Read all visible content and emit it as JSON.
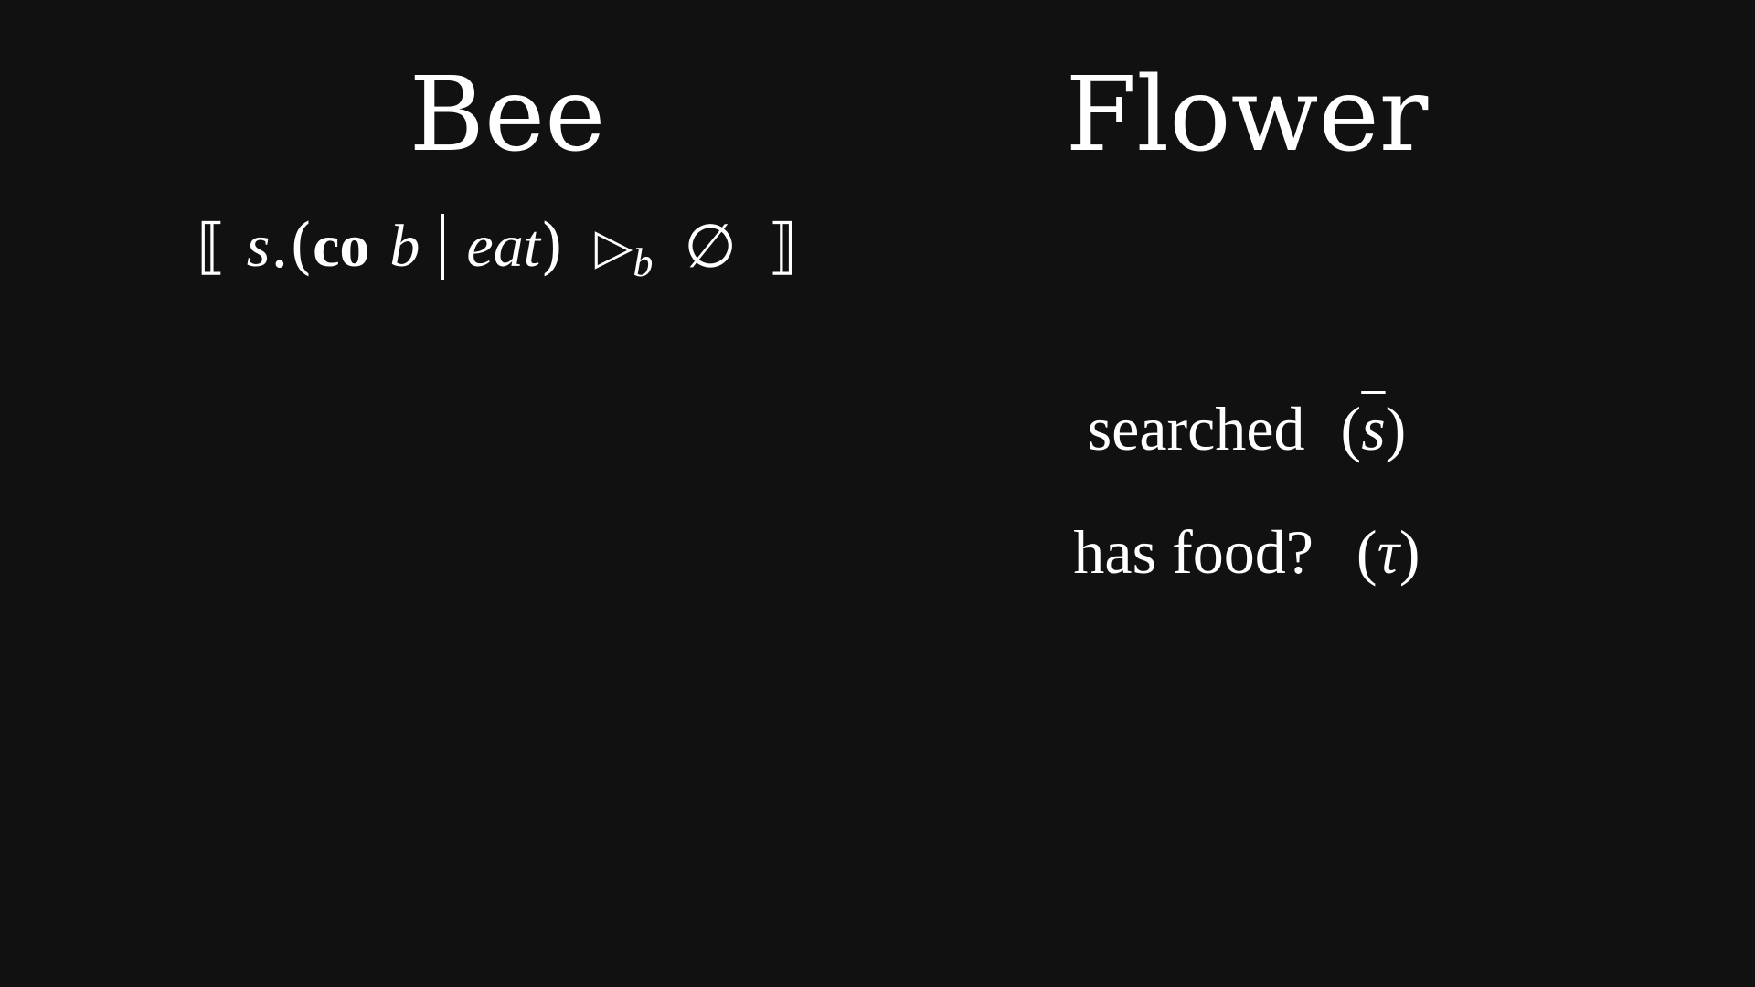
{
  "bee": {
    "title": "Bee",
    "formula": {
      "open_bracket": "⟦",
      "s": "s",
      "dot_paren": ".(",
      "co": "co",
      "b": "b",
      "eat": "eat",
      "close_paren": ")",
      "triangle": "▷",
      "subscript": "b",
      "emptyset": "∅",
      "close_bracket": "⟧"
    }
  },
  "flower": {
    "title": "Flower",
    "searched_label": "searched",
    "searched_symbol": "s",
    "food_label": "has food?",
    "food_symbol": "τ"
  }
}
